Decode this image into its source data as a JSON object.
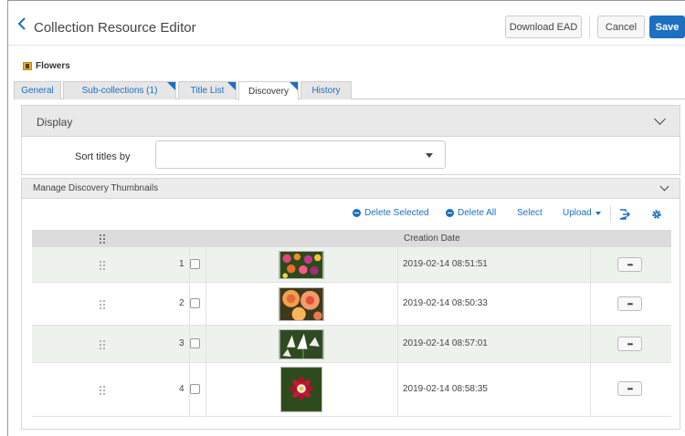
{
  "header": {
    "title": "Collection Resource Editor",
    "download_label": "Download EAD",
    "cancel_label": "Cancel",
    "save_label": "Save"
  },
  "breadcrumb": {
    "collection_name": "Flowers"
  },
  "tabs": [
    {
      "label": "General",
      "active": false
    },
    {
      "label": "Sub-collections (1)",
      "active": false
    },
    {
      "label": "Title List",
      "active": false
    },
    {
      "label": "Discovery",
      "active": true
    },
    {
      "label": "History",
      "active": false
    }
  ],
  "display": {
    "header": "Display",
    "sort_label": "Sort titles by",
    "sort_value": ""
  },
  "thumbnails": {
    "header": "Manage Discovery Thumbnails",
    "toolbar": {
      "delete_selected": "Delete Selected",
      "delete_all": "Delete All",
      "select": "Select",
      "upload": "Upload"
    },
    "column_creation_date": "Creation Date",
    "rows": [
      {
        "index": "1",
        "date": "2019-02-14 08:51:51",
        "thumbnail": "mixed-flowers-thumbnail"
      },
      {
        "index": "2",
        "date": "2019-02-14 08:50:33",
        "thumbnail": "orange-roses-thumbnail"
      },
      {
        "index": "3",
        "date": "2019-02-14 08:57:01",
        "thumbnail": "white-lilies-thumbnail"
      },
      {
        "index": "4",
        "date": "2019-02-14 08:58:35",
        "thumbnail": "red-dahlia-thumbnail"
      }
    ],
    "row_action_label": "•••"
  },
  "colors": {
    "accent": "#1d6fc0",
    "alt_row": "#eef2ec",
    "header_gray": "#e9e9e9"
  }
}
